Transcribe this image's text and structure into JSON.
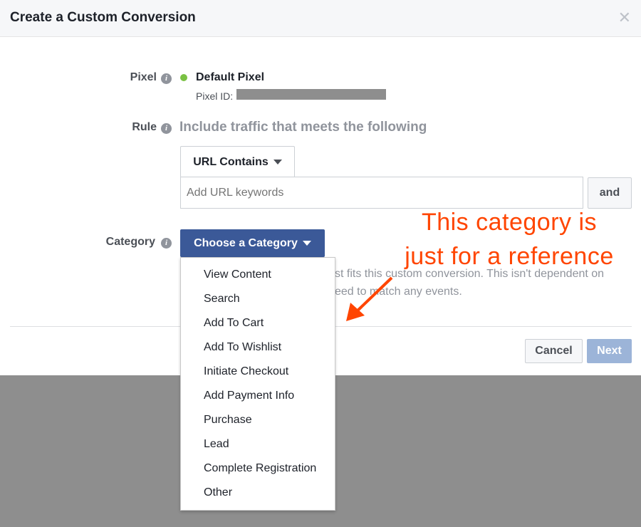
{
  "dialog": {
    "title": "Create a Custom Conversion",
    "close_icon": "close-icon"
  },
  "pixel": {
    "label": "Pixel",
    "name": "Default Pixel",
    "id_label": "Pixel ID:",
    "status_color": "#7ac143"
  },
  "rule": {
    "label": "Rule",
    "heading": "Include traffic that meets the following",
    "match_type": "URL Contains",
    "keywords_placeholder": "Add URL keywords",
    "and_label": "and"
  },
  "category": {
    "label": "Category",
    "button_label": "Choose a Category",
    "help_line1": "st fits this custom conversion. This isn't dependent on",
    "help_line2": "eed to match any events.",
    "options": [
      "View Content",
      "Search",
      "Add To Cart",
      "Add To Wishlist",
      "Initiate Checkout",
      "Add Payment Info",
      "Purchase",
      "Lead",
      "Complete Registration",
      "Other"
    ]
  },
  "footer": {
    "cancel_label": "Cancel",
    "next_label": "Next"
  },
  "annotation": {
    "line1": "This category is",
    "line2": "just for a reference",
    "color": "#ff4500"
  }
}
